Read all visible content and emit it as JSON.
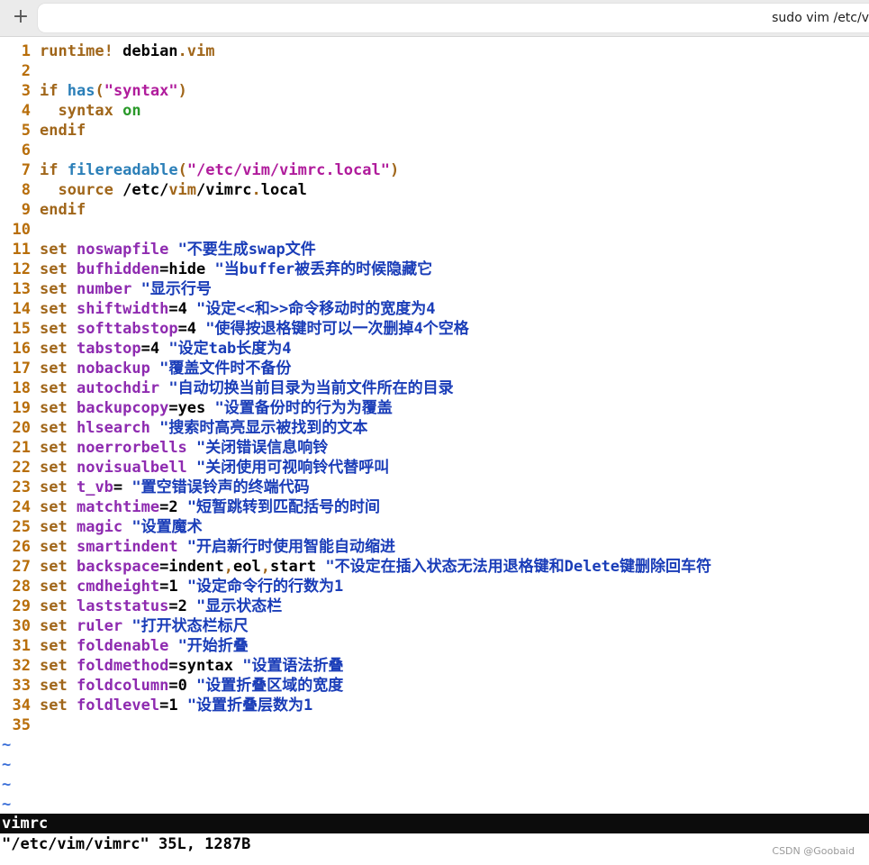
{
  "window": {
    "new_tab_symbol": "+",
    "tab_title": "sudo vim /etc/v"
  },
  "lines": [
    [
      {
        "t": "runtime!",
        "c": "kw"
      },
      {
        "t": " debian",
        "c": ""
      },
      {
        "t": ".",
        "c": "kw"
      },
      {
        "t": "vim",
        "c": "kw"
      }
    ],
    [],
    [
      {
        "t": "if",
        "c": "kw"
      },
      {
        "t": " ",
        "c": ""
      },
      {
        "t": "has",
        "c": "fn"
      },
      {
        "t": "(",
        "c": "kw"
      },
      {
        "t": "\"syntax\"",
        "c": "str"
      },
      {
        "t": ")",
        "c": "kw"
      }
    ],
    [
      {
        "t": "  syntax",
        "c": "kw"
      },
      {
        "t": " ",
        "c": ""
      },
      {
        "t": "on",
        "c": "on"
      }
    ],
    [
      {
        "t": "endif",
        "c": "kw"
      }
    ],
    [],
    [
      {
        "t": "if",
        "c": "kw"
      },
      {
        "t": " ",
        "c": ""
      },
      {
        "t": "filereadable",
        "c": "fn"
      },
      {
        "t": "(",
        "c": "kw"
      },
      {
        "t": "\"/etc/vim/vimrc.local\"",
        "c": "str"
      },
      {
        "t": ")",
        "c": "kw"
      }
    ],
    [
      {
        "t": "  source",
        "c": "kw"
      },
      {
        "t": " /etc/",
        "c": ""
      },
      {
        "t": "vim",
        "c": "kw"
      },
      {
        "t": "/vimrc",
        "c": ""
      },
      {
        "t": ".",
        "c": "kw"
      },
      {
        "t": "local",
        "c": ""
      }
    ],
    [
      {
        "t": "endif",
        "c": "kw"
      }
    ],
    [],
    [
      {
        "t": "set",
        "c": "kw"
      },
      {
        "t": " ",
        "c": ""
      },
      {
        "t": "noswapfile",
        "c": "opt"
      },
      {
        "t": " \"不要生成swap文件",
        "c": "cm"
      }
    ],
    [
      {
        "t": "set",
        "c": "kw"
      },
      {
        "t": " ",
        "c": ""
      },
      {
        "t": "bufhidden",
        "c": "opt"
      },
      {
        "t": "=hide",
        "c": ""
      },
      {
        "t": " \"当buffer被丢弃的时候隐藏它",
        "c": "cm"
      }
    ],
    [
      {
        "t": "set",
        "c": "kw"
      },
      {
        "t": " ",
        "c": ""
      },
      {
        "t": "number",
        "c": "opt"
      },
      {
        "t": " \"显示行号",
        "c": "cm"
      }
    ],
    [
      {
        "t": "set",
        "c": "kw"
      },
      {
        "t": " ",
        "c": ""
      },
      {
        "t": "shiftwidth",
        "c": "opt"
      },
      {
        "t": "=4",
        "c": ""
      },
      {
        "t": " \"设定<<和>>命令移动时的宽度为4",
        "c": "cm"
      }
    ],
    [
      {
        "t": "set",
        "c": "kw"
      },
      {
        "t": " ",
        "c": ""
      },
      {
        "t": "softtabstop",
        "c": "opt"
      },
      {
        "t": "=4",
        "c": ""
      },
      {
        "t": " \"使得按退格键时可以一次删掉4个空格",
        "c": "cm"
      }
    ],
    [
      {
        "t": "set",
        "c": "kw"
      },
      {
        "t": " ",
        "c": ""
      },
      {
        "t": "tabstop",
        "c": "opt"
      },
      {
        "t": "=4",
        "c": ""
      },
      {
        "t": " \"设定tab长度为4",
        "c": "cm"
      }
    ],
    [
      {
        "t": "set",
        "c": "kw"
      },
      {
        "t": " ",
        "c": ""
      },
      {
        "t": "nobackup",
        "c": "opt"
      },
      {
        "t": " \"覆盖文件时不备份",
        "c": "cm"
      }
    ],
    [
      {
        "t": "set",
        "c": "kw"
      },
      {
        "t": " ",
        "c": ""
      },
      {
        "t": "autochdir",
        "c": "opt"
      },
      {
        "t": " \"自动切换当前目录为当前文件所在的目录",
        "c": "cm"
      }
    ],
    [
      {
        "t": "set",
        "c": "kw"
      },
      {
        "t": " ",
        "c": ""
      },
      {
        "t": "backupcopy",
        "c": "opt"
      },
      {
        "t": "=yes",
        "c": ""
      },
      {
        "t": " \"设置备份时的行为为覆盖",
        "c": "cm"
      }
    ],
    [
      {
        "t": "set",
        "c": "kw"
      },
      {
        "t": " ",
        "c": ""
      },
      {
        "t": "hlsearch",
        "c": "opt"
      },
      {
        "t": " \"搜索时高亮显示被找到的文本",
        "c": "cm"
      }
    ],
    [
      {
        "t": "set",
        "c": "kw"
      },
      {
        "t": " ",
        "c": ""
      },
      {
        "t": "noerrorbells",
        "c": "opt"
      },
      {
        "t": " \"关闭错误信息响铃",
        "c": "cm"
      }
    ],
    [
      {
        "t": "set",
        "c": "kw"
      },
      {
        "t": " ",
        "c": ""
      },
      {
        "t": "novisualbell",
        "c": "opt"
      },
      {
        "t": " \"关闭使用可视响铃代替呼叫",
        "c": "cm"
      }
    ],
    [
      {
        "t": "set",
        "c": "kw"
      },
      {
        "t": " ",
        "c": ""
      },
      {
        "t": "t_vb",
        "c": "opt"
      },
      {
        "t": "=",
        "c": ""
      },
      {
        "t": " \"置空错误铃声的终端代码",
        "c": "cm"
      }
    ],
    [
      {
        "t": "set",
        "c": "kw"
      },
      {
        "t": " ",
        "c": ""
      },
      {
        "t": "matchtime",
        "c": "opt"
      },
      {
        "t": "=2",
        "c": ""
      },
      {
        "t": " \"短暂跳转到匹配括号的时间",
        "c": "cm"
      }
    ],
    [
      {
        "t": "set",
        "c": "kw"
      },
      {
        "t": " ",
        "c": ""
      },
      {
        "t": "magic",
        "c": "opt"
      },
      {
        "t": " \"设置魔术",
        "c": "cm"
      }
    ],
    [
      {
        "t": "set",
        "c": "kw"
      },
      {
        "t": " ",
        "c": ""
      },
      {
        "t": "smartindent",
        "c": "opt"
      },
      {
        "t": " \"开启新行时使用智能自动缩进",
        "c": "cm"
      }
    ],
    [
      {
        "t": "set",
        "c": "kw"
      },
      {
        "t": " ",
        "c": ""
      },
      {
        "t": "backspace",
        "c": "opt"
      },
      {
        "t": "=indent",
        "c": ""
      },
      {
        "t": ",",
        "c": "kw"
      },
      {
        "t": "eol",
        "c": ""
      },
      {
        "t": ",",
        "c": "kw"
      },
      {
        "t": "start",
        "c": ""
      },
      {
        "t": " \"不设定在插入状态无法用退格键和Delete键删除回车符",
        "c": "cm"
      }
    ],
    [
      {
        "t": "set",
        "c": "kw"
      },
      {
        "t": " ",
        "c": ""
      },
      {
        "t": "cmdheight",
        "c": "opt"
      },
      {
        "t": "=1",
        "c": ""
      },
      {
        "t": " \"设定命令行的行数为1",
        "c": "cm"
      }
    ],
    [
      {
        "t": "set",
        "c": "kw"
      },
      {
        "t": " ",
        "c": ""
      },
      {
        "t": "laststatus",
        "c": "opt"
      },
      {
        "t": "=2",
        "c": ""
      },
      {
        "t": " \"显示状态栏",
        "c": "cm"
      }
    ],
    [
      {
        "t": "set",
        "c": "kw"
      },
      {
        "t": " ",
        "c": ""
      },
      {
        "t": "ruler",
        "c": "opt"
      },
      {
        "t": " \"打开状态栏标尺",
        "c": "cm"
      }
    ],
    [
      {
        "t": "set",
        "c": "kw"
      },
      {
        "t": " ",
        "c": ""
      },
      {
        "t": "foldenable",
        "c": "opt"
      },
      {
        "t": " \"开始折叠",
        "c": "cm"
      }
    ],
    [
      {
        "t": "set",
        "c": "kw"
      },
      {
        "t": " ",
        "c": ""
      },
      {
        "t": "foldmethod",
        "c": "opt"
      },
      {
        "t": "=syntax",
        "c": ""
      },
      {
        "t": " \"设置语法折叠",
        "c": "cm"
      }
    ],
    [
      {
        "t": "set",
        "c": "kw"
      },
      {
        "t": " ",
        "c": ""
      },
      {
        "t": "foldcolumn",
        "c": "opt"
      },
      {
        "t": "=0",
        "c": ""
      },
      {
        "t": " \"设置折叠区域的宽度",
        "c": "cm"
      }
    ],
    [
      {
        "t": "set",
        "c": "kw"
      },
      {
        "t": " ",
        "c": ""
      },
      {
        "t": "foldlevel",
        "c": "opt"
      },
      {
        "t": "=1",
        "c": ""
      },
      {
        "t": " \"设置折叠层数为1",
        "c": "cm"
      }
    ],
    []
  ],
  "empty_line_marker": "~",
  "empty_line_count": 4,
  "status_line": "vimrc",
  "message_line": "\"/etc/vim/vimrc\" 35L, 1287B",
  "watermark": "CSDN @Goobaid",
  "colors": {
    "line_number": "#b86e0a",
    "keyword": "#a0661a",
    "option": "#8e2bb0",
    "string": "#b01c9c",
    "comment": "#1a3db8",
    "constant": "#2a9a2a",
    "function": "#2b7fb8",
    "tilde": "#3a6fd8",
    "statusbar_bg": "#0c0c0c"
  }
}
